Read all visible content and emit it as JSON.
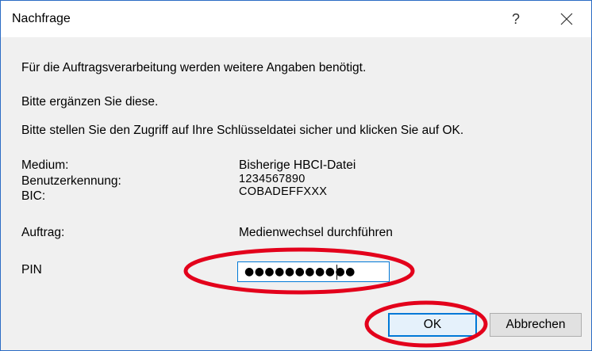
{
  "window": {
    "title": "Nachfrage"
  },
  "titlebar": {
    "help_glyph": "?"
  },
  "messages": {
    "line1": "Für die Auftragsverarbeitung werden weitere Angaben benötigt.",
    "line2": "Bitte ergänzen Sie diese.",
    "line3": "Bitte stellen Sie den Zugriff auf Ihre Schlüsseldatei sicher und klicken Sie auf OK."
  },
  "details": [
    {
      "label": "Medium:",
      "value": "Bisherige HBCI-Datei"
    },
    {
      "label": "Benutzerkennung:",
      "value": "1234567890"
    },
    {
      "label": "BIC:",
      "value": "COBADEFFXXX"
    },
    {
      "label": "Auftrag:",
      "value": "Medienwechsel durchführen"
    }
  ],
  "pin": {
    "label": "PIN",
    "masked_value": "●●●●●●●●●●●"
  },
  "buttons": {
    "ok": "OK",
    "cancel": "Abbrechen"
  },
  "annotation_color": "#e3001b"
}
